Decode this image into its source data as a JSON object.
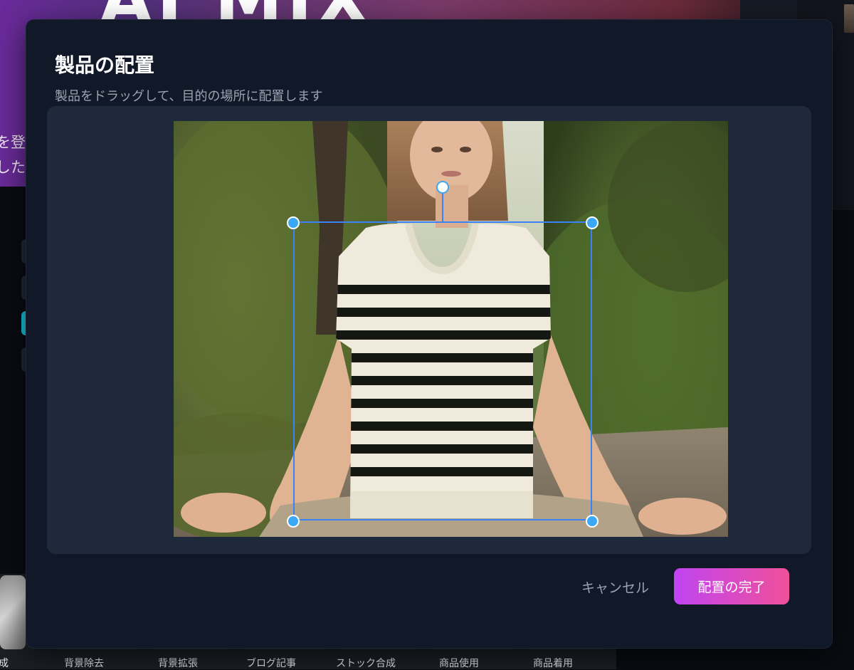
{
  "background": {
    "hero_title": "AI MIX",
    "hero_line1": "を登",
    "hero_line2": "した",
    "feature_labels": [
      "成",
      "背景除去",
      "背景拡張",
      "ブログ記事",
      "ストック合成",
      "商品使用",
      "商品着用"
    ]
  },
  "modal": {
    "title": "製品の配置",
    "subtitle": "製品をドラッグして、目的の場所に配置します",
    "cancel_label": "キャンセル",
    "confirm_label": "配置の完了"
  },
  "colors": {
    "modal_bg": "#111827",
    "canvas_bg": "#1e293b",
    "selection": "#3b82f6",
    "handle": "#3ba8f5",
    "confirm_gradient_start": "#c044f2",
    "confirm_gradient_end": "#f0509a"
  }
}
